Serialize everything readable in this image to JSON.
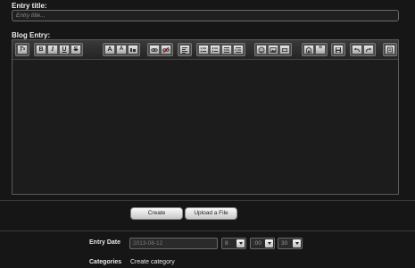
{
  "entry_title": {
    "label": "Entry title:",
    "placeholder": "Entry title..."
  },
  "blog_entry": {
    "label": "Blog Entry:",
    "toolbar": [
      [
        "clear-format"
      ],
      [
        "bold",
        "italic",
        "underline",
        "strikethrough"
      ],
      [
        "font-size",
        "font-color",
        "font-family"
      ],
      [
        "link",
        "unlink"
      ],
      [
        "align-left"
      ],
      [
        "bullet-list",
        "number-list",
        "outdent",
        "indent"
      ],
      [
        "emoticon",
        "image",
        "media",
        "quote"
      ],
      [
        "save"
      ],
      [
        "undo",
        "redo"
      ],
      [
        "help"
      ]
    ],
    "toolbar_glyphs": {
      "bold": "B",
      "italic": "I",
      "underline": "U",
      "strikethrough": "S",
      "font_size": "A",
      "font_color": "A"
    }
  },
  "buttons": {
    "create": "Create",
    "upload": "Upload a File"
  },
  "entry_date": {
    "label": "Entry Date",
    "date_value": "2013-08-12",
    "hour": "8",
    "minute": ":00",
    "ampm": "30"
  },
  "categories": {
    "label": "Categories",
    "link": "Create category"
  }
}
